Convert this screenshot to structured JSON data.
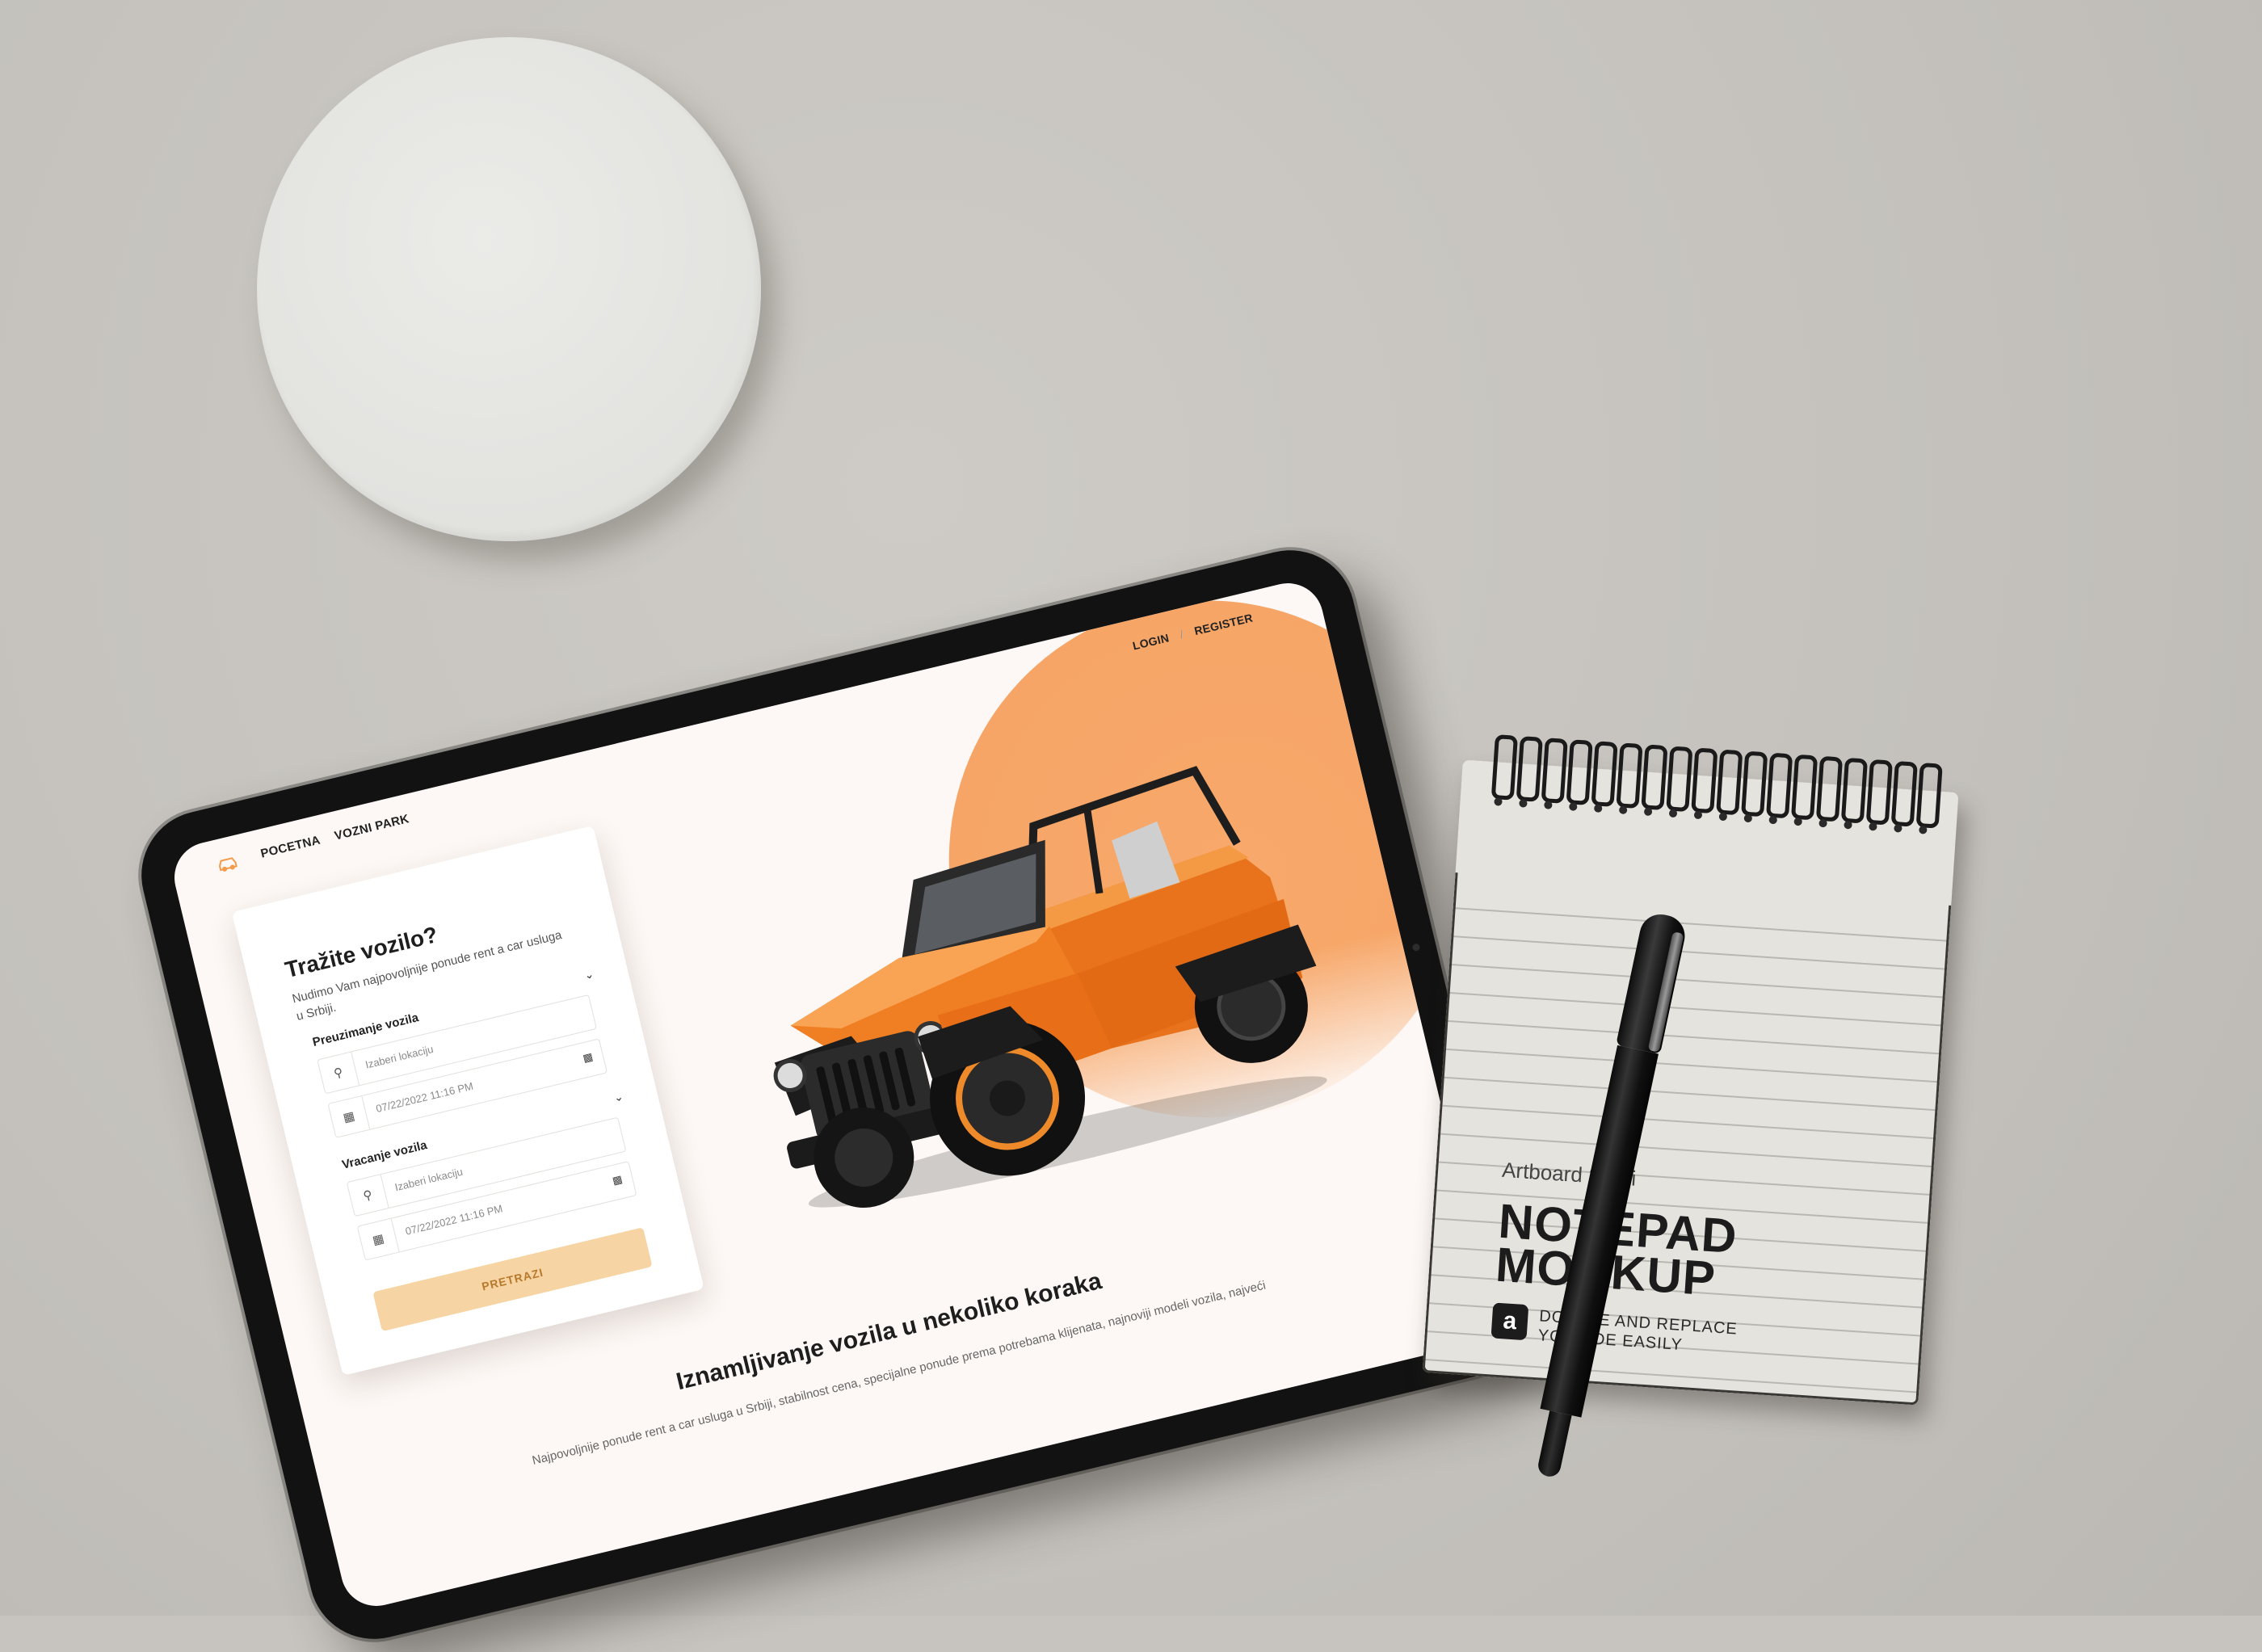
{
  "colors": {
    "accent": "#f39b4b",
    "hero_circle": "#f6a465",
    "search_button_bg": "#f7d4a3",
    "search_button_text": "#b77a2d",
    "desk": "#c7c4bf"
  },
  "nav": {
    "logo_icon": "car-icon",
    "items": [
      {
        "label": "POCETNA"
      },
      {
        "label": "VOZNI PARK"
      }
    ],
    "login": "LOGIN",
    "separator": "/",
    "register": "REGISTER"
  },
  "search_card": {
    "title": "Tražite vozilo?",
    "subtitle": "Nudimo Vam najpovoljnije ponude rent a car usluga u Srbiji.",
    "pickup": {
      "label": "Preuzimanje vozila",
      "location_placeholder": "Izaberi lokaciju",
      "datetime": "07/22/2022 11:16 PM"
    },
    "return": {
      "label": "Vracanje vozila",
      "location_placeholder": "Izaberi lokaciju",
      "datetime": "07/22/2022 11:16 PM"
    },
    "search_button": "PRETRAZI"
  },
  "steps": {
    "title": "Iznamljivanje vozila u nekoliko koraka",
    "text": "Najpovoljnije ponude rent a car usluga u Srbiji, stabilnost cena, specijalne ponude prema potrebama klijenata, najnoviji modeli vozila, najveći"
  },
  "notepad": {
    "studio": "Artboard Studi",
    "title_line1": "NOTEPAD",
    "title_line2": "MOCKUP",
    "badge": "a",
    "subtitle_line1": "DOUBLE   AND REPLACE",
    "subtitle_line2": "YOUR DE   EASILY"
  }
}
